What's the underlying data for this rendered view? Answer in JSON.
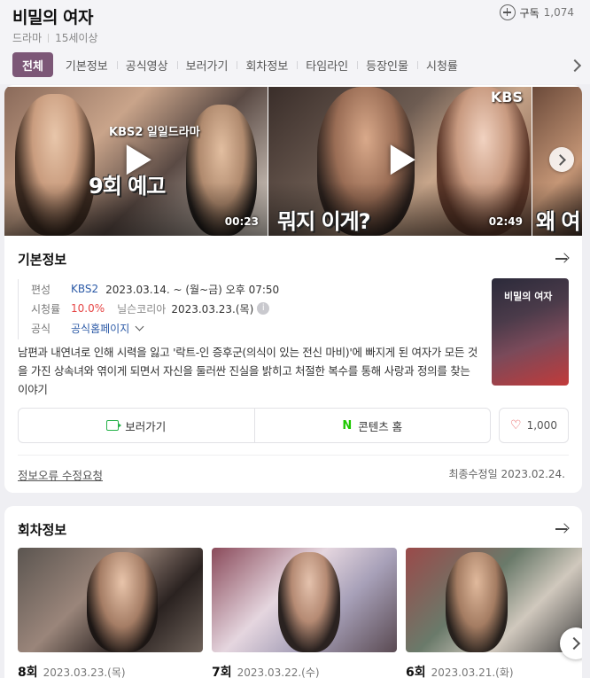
{
  "header": {
    "title": "비밀의 여자",
    "subscribe_label": "구독",
    "subscribe_count": "1,074",
    "genre": "드라마",
    "rating": "15세이상"
  },
  "tabs": [
    {
      "label": "전체",
      "active": true
    },
    {
      "label": "기본정보"
    },
    {
      "label": "공식영상"
    },
    {
      "label": "보러가기"
    },
    {
      "label": "회차정보"
    },
    {
      "label": "타임라인"
    },
    {
      "label": "등장인물"
    },
    {
      "label": "시청률"
    }
  ],
  "videos": [
    {
      "caption": "9회 예고",
      "logo": "KBS2 일일드라마",
      "duration": "00:23"
    },
    {
      "caption": "뭐지 이게?",
      "logo": "KBS",
      "duration": "02:49"
    },
    {
      "caption": "왜 여",
      "logo": "",
      "duration": ""
    }
  ],
  "basic_info": {
    "heading": "기본정보",
    "broadcast_key": "편성",
    "channel": "KBS2",
    "schedule": "2023.03.14. ~ (월~금) 오후 07:50",
    "rating_key": "시청률",
    "rating_value": "10.0%",
    "rating_source": "닐슨코리아",
    "rating_date": "2023.03.23.(목)",
    "official_key": "공식",
    "official_value": "공식홈페이지",
    "poster_title": "비밀의 여자",
    "description": "남편과 내연녀로 인해 시력을 잃고 '락트-인 증후군(의식이 있는 전신 마비)'에 빠지게 된 여자가 모든 것을 가진 상속녀와 엮이게 되면서 자신을 둘러싼 진실을 밝히고 처절한 복수를 통해 사랑과 정의를 찾는 이야기",
    "watch_label": "보러가기",
    "content_home_label": "콘텐츠 홈",
    "like_count": "1,000",
    "report_label": "정보오류 수정요청",
    "updated_label": "최종수정일",
    "updated_date": "2023.02.24."
  },
  "episodes_section": {
    "heading": "회차정보",
    "episodes": [
      {
        "number": "8회",
        "date": "2023.03.23.(목)"
      },
      {
        "number": "7회",
        "date": "2023.03.22.(수)"
      },
      {
        "number": "6회",
        "date": "2023.03.21.(화)"
      }
    ]
  }
}
